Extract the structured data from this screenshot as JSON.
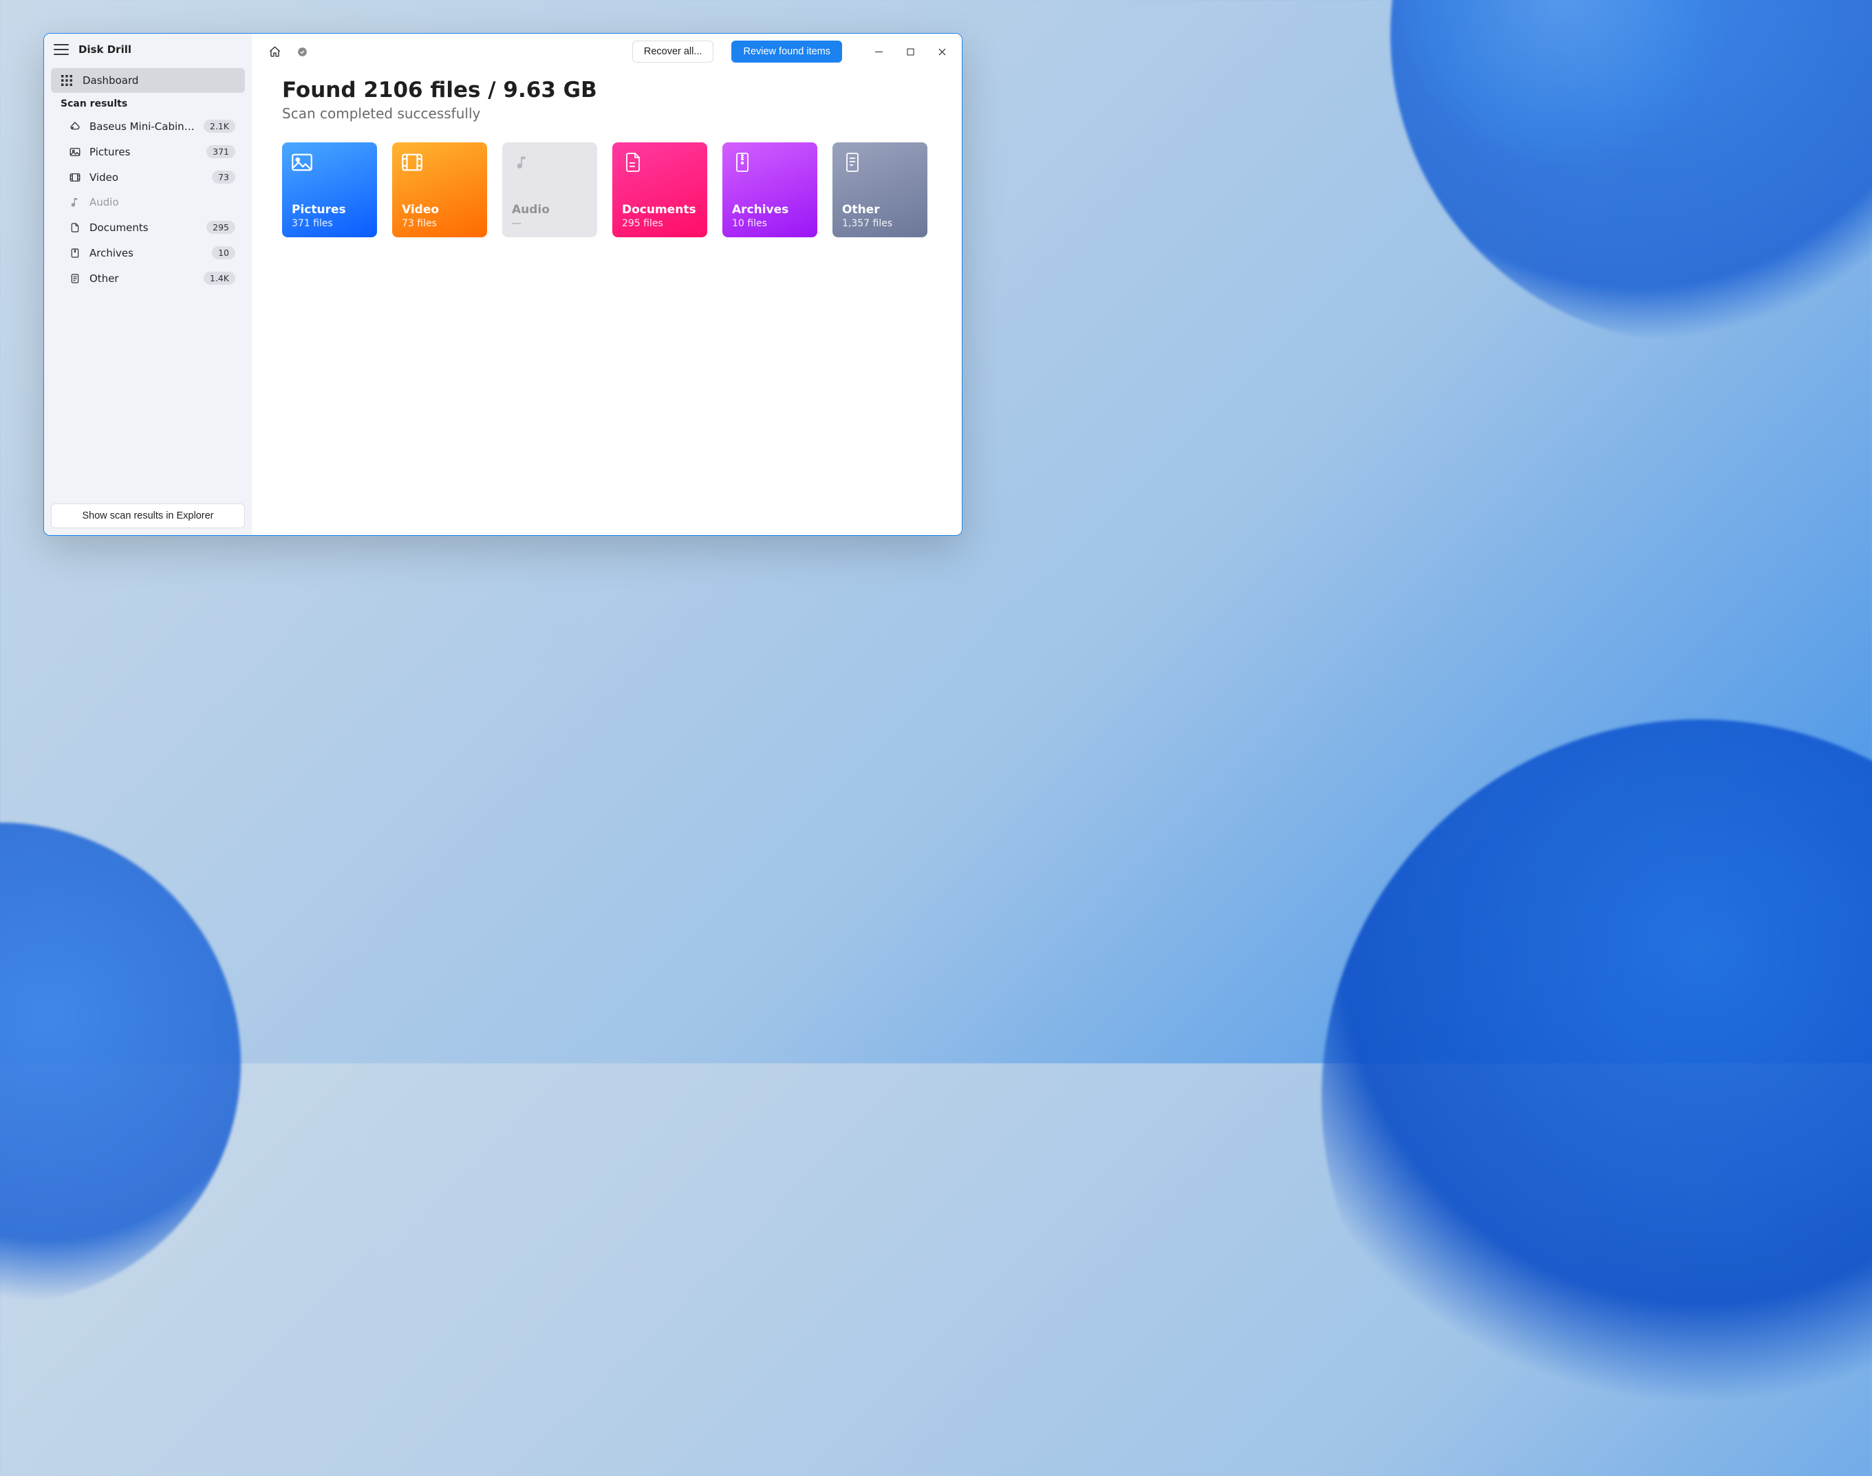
{
  "app": {
    "title": "Disk Drill"
  },
  "sidebar": {
    "dashboard_label": "Dashboard",
    "scan_results_label": "Scan results",
    "items": [
      {
        "id": "device",
        "label": "Baseus Mini-Cabin Card...",
        "badge": "2.1K",
        "muted": false
      },
      {
        "id": "pictures",
        "label": "Pictures",
        "badge": "371",
        "muted": false
      },
      {
        "id": "video",
        "label": "Video",
        "badge": "73",
        "muted": false
      },
      {
        "id": "audio",
        "label": "Audio",
        "badge": "",
        "muted": true
      },
      {
        "id": "documents",
        "label": "Documents",
        "badge": "295",
        "muted": false
      },
      {
        "id": "archives",
        "label": "Archives",
        "badge": "10",
        "muted": false
      },
      {
        "id": "other",
        "label": "Other",
        "badge": "1.4K",
        "muted": false
      }
    ],
    "show_in_explorer_label": "Show scan results in Explorer"
  },
  "toolbar": {
    "recover_all_label": "Recover all...",
    "review_label": "Review found items"
  },
  "main": {
    "headline": "Found 2106 files / 9.63 GB",
    "subhead": "Scan completed successfully"
  },
  "cards": [
    {
      "id": "pictures",
      "title": "Pictures",
      "sub": "371 files",
      "color": "blue",
      "interactable": true
    },
    {
      "id": "video",
      "title": "Video",
      "sub": "73 files",
      "color": "orange",
      "interactable": true
    },
    {
      "id": "audio",
      "title": "Audio",
      "sub": "—",
      "color": "gray",
      "interactable": false
    },
    {
      "id": "documents",
      "title": "Documents",
      "sub": "295 files",
      "color": "pink",
      "interactable": true
    },
    {
      "id": "archives",
      "title": "Archives",
      "sub": "10 files",
      "color": "purple",
      "interactable": true
    },
    {
      "id": "other",
      "title": "Other",
      "sub": "1,357 files",
      "color": "slate",
      "interactable": true
    }
  ],
  "colors": {
    "accent": "#1b82f0"
  }
}
